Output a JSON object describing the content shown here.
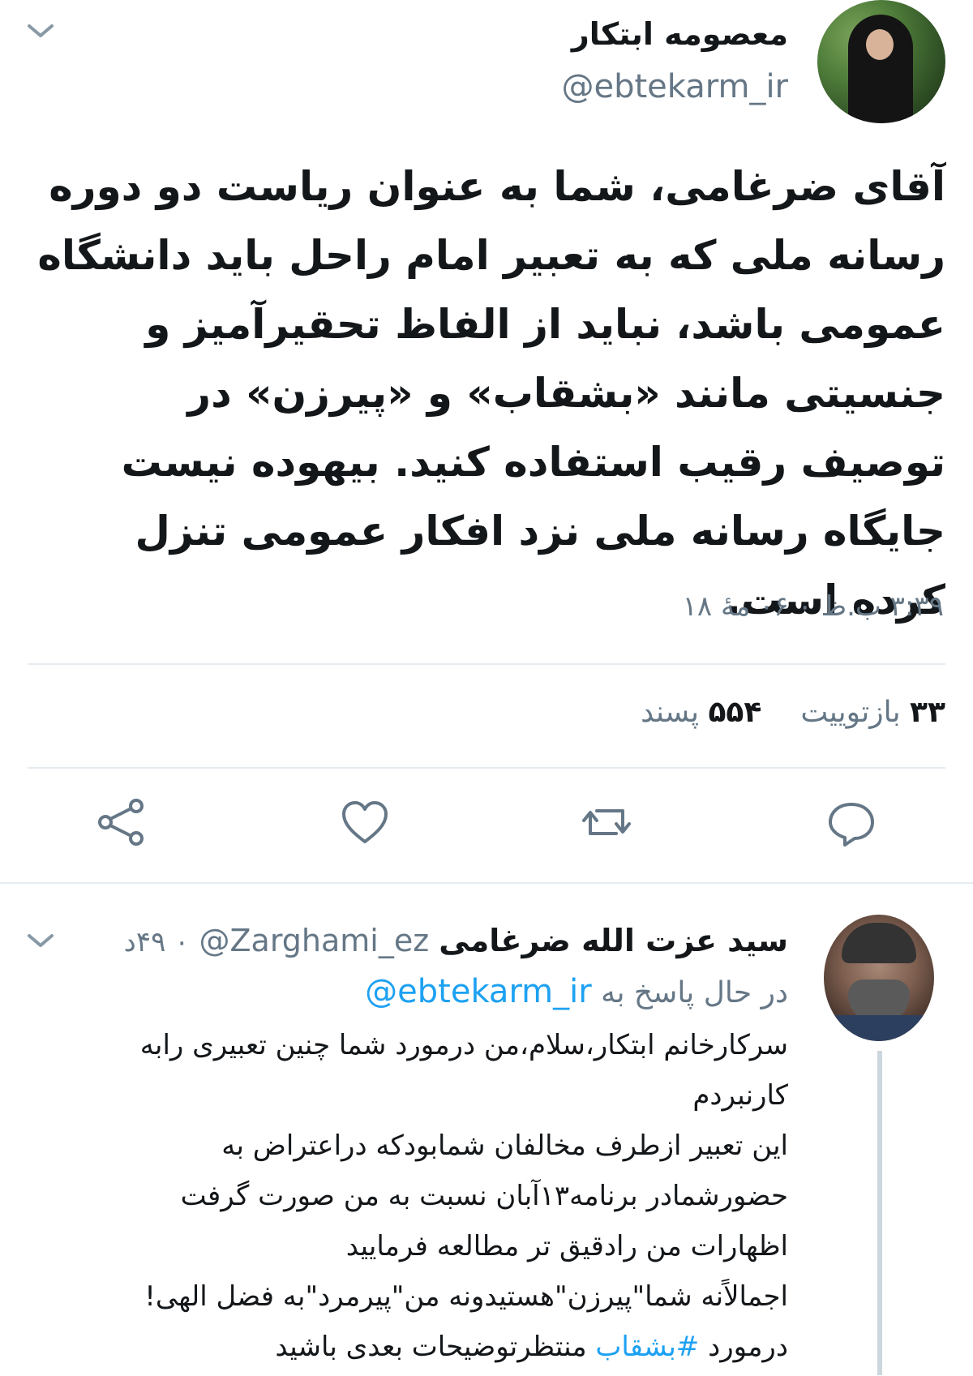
{
  "main_tweet": {
    "display_name": "معصومه ابتکار",
    "handle": "@ebtekarm_ir",
    "text": "آقای ضرغامی، شما به عنوان ریاست دو دوره رسانه ملی که به تعبیر امام راحل باید دانشگاه عمومی باشد، نباید از الفاظ تحقیرآمیز و جنسیتی مانند «بشقاب» و «پیرزن» در توصیف رقیب استفاده کنید. بیهوده نیست جایگاه رسانه ملی نزد افکار عمومی تنزل کرده است.",
    "timestamp": "۳:۳۹ ب.ظ ۰ ۰۶ مهٔ ۱۸",
    "retweets_count": "۳۳",
    "retweets_label": "بازتوییت",
    "likes_count": "۵۵۴",
    "likes_label": "پسند",
    "actions": [
      "reply-icon",
      "retweet-icon",
      "heart-icon",
      "share-icon"
    ]
  },
  "reply_tweet": {
    "display_name": "سید عزت الله ضرغامی",
    "handle": "@Zarghami_ez",
    "time": "۰ ۴۹د",
    "replying_prefix": "در حال پاسخ به",
    "replying_to": "@ebtekarm_ir",
    "lines": [
      "سرکارخانم ابتکار،سلام،من درمورد شما چنین تعبیری رابه",
      "کارنبردم",
      "این تعبیر ازطرف مخالفان شمابودکه دراعتراض به",
      "حضورشمادر برنامه۱۳آبان نسبت به من صورت گرفت",
      "اظهارات من رادقیق تر مطالعه فرمایید",
      "اجمالاًنه شما\"پیرزن\"هستیدونه من\"پیرمرد\"به فضل الهی!"
    ],
    "last_line_prefix": "درمورد",
    "hashtag": "#بشقاب",
    "last_line_suffix": "منتظرتوضیحات بعدی باشید"
  },
  "colors": {
    "text": "#14171a",
    "secondary": "#657786",
    "link": "#1da1f2",
    "divider": "#e6ecf0"
  }
}
